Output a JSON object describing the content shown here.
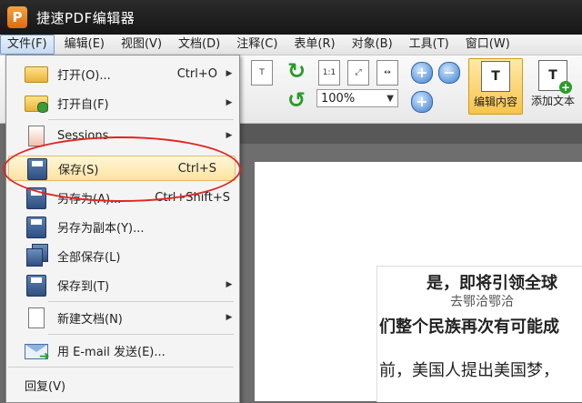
{
  "app": {
    "logo": "P",
    "title": "捷速PDF编辑器"
  },
  "menubar": [
    {
      "label": "文件(F)",
      "active": true
    },
    {
      "label": "编辑(E)"
    },
    {
      "label": "视图(V)"
    },
    {
      "label": "文档(D)"
    },
    {
      "label": "注释(C)"
    },
    {
      "label": "表单(R)"
    },
    {
      "label": "对象(B)"
    },
    {
      "label": "工具(T)"
    },
    {
      "label": "窗口(W)"
    }
  ],
  "toolbar": {
    "zoom_value": "100%",
    "page_fit_label": "1:1",
    "edit_content_label": "编辑内容",
    "add_text_label": "添加文本",
    "colors": {
      "accent_green": "#2a9a2a",
      "highlight": "#f7c44c"
    }
  },
  "file_menu": {
    "items": [
      {
        "label": "打开(O)...",
        "shortcut": "Ctrl+O",
        "submenu": true,
        "icon": "folder-icon"
      },
      {
        "label": "打开自(F)",
        "shortcut": "",
        "submenu": true,
        "icon": "folder-globe-icon"
      },
      {
        "label": "Sessions",
        "shortcut": "",
        "submenu": true,
        "icon": "sessions-icon"
      },
      {
        "label": "保存(S)",
        "shortcut": "Ctrl+S",
        "submenu": false,
        "icon": "floppy-icon",
        "highlighted": true
      },
      {
        "label": "另存为(A)...",
        "shortcut": "Ctrl+Shift+S",
        "submenu": false,
        "icon": "floppy-saveas-icon"
      },
      {
        "label": "另存为副本(Y)...",
        "shortcut": "",
        "submenu": false,
        "icon": "floppy-copy-icon"
      },
      {
        "label": "全部保存(L)",
        "shortcut": "",
        "submenu": false,
        "icon": "floppy-stack-icon"
      },
      {
        "label": "保存到(T)",
        "shortcut": "",
        "submenu": true,
        "icon": "floppy-to-icon"
      },
      {
        "label": "新建文档(N)",
        "shortcut": "",
        "submenu": true,
        "icon": "new-document-icon"
      },
      {
        "label": "用 E-mail 发送(E)...",
        "shortcut": "",
        "submenu": false,
        "icon": "email-icon"
      },
      {
        "label": "回复(V)",
        "shortcut": "",
        "submenu": false,
        "icon": ""
      }
    ],
    "annotation_color": "#e2241f"
  },
  "document": {
    "line1": "是，即将引领全球",
    "line1b": "去鄂洽鄂洽",
    "line2": "们整个民族再次有可能成",
    "line3": "前，美国人提出美国梦，"
  }
}
